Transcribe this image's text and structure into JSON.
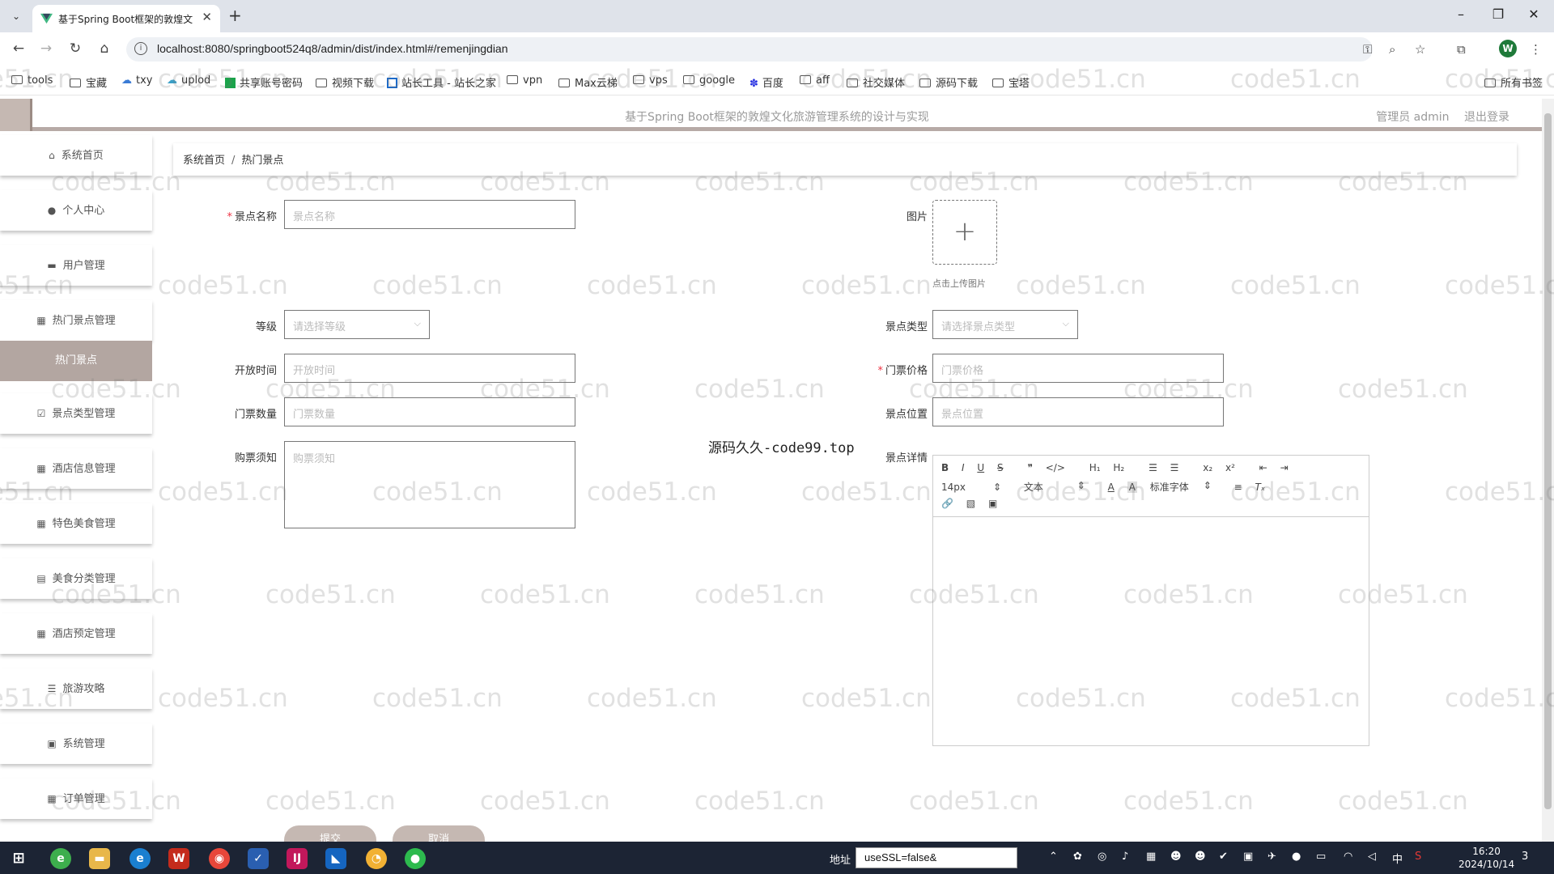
{
  "browser": {
    "tab_title": "基于Spring Boot框架的敦煌文",
    "new_tab_symbol": "+",
    "url": "localhost:8080/springboot524q8/admin/dist/index.html#/remenjingdian",
    "profile_initial": "W",
    "bookmarks": [
      "tools",
      "宝藏",
      "txy",
      "uplod",
      "共享账号密码",
      "视频下载",
      "站长工具 - 站长之家",
      "vpn",
      "Max云梯",
      "vps",
      "google",
      "百度",
      "aff",
      "社交媒体",
      "源码下载",
      "宝塔",
      "所有书签"
    ]
  },
  "header": {
    "title": "基于Spring Boot框架的敦煌文化旅游管理系统的设计与实现",
    "user_label": "管理员 admin",
    "logout": "退出登录"
  },
  "sidebar": {
    "items": [
      {
        "label": "系统首页",
        "icon": "home-icon"
      },
      {
        "label": "个人中心",
        "icon": "user-icon"
      },
      {
        "label": "用户管理",
        "icon": "users-icon"
      },
      {
        "label": "热门景点管理",
        "icon": "grid-icon"
      },
      {
        "label": "热门景点",
        "icon": ""
      },
      {
        "label": "景点类型管理",
        "icon": "check-square-icon"
      },
      {
        "label": "酒店信息管理",
        "icon": "grid-icon"
      },
      {
        "label": "特色美食管理",
        "icon": "grid-icon"
      },
      {
        "label": "美食分类管理",
        "icon": "clipboard-icon"
      },
      {
        "label": "酒店预定管理",
        "icon": "grid-icon"
      },
      {
        "label": "旅游攻略",
        "icon": "list-icon"
      },
      {
        "label": "系统管理",
        "icon": "clipboard-check-icon"
      },
      {
        "label": "订单管理",
        "icon": "grid-icon"
      }
    ],
    "active_color": "#b3a6a1"
  },
  "breadcrumb": {
    "home": "系统首页",
    "separator": "/",
    "current": "热门景点"
  },
  "form": {
    "name_label": "景点名称",
    "name_placeholder": "景点名称",
    "image_label": "图片",
    "upload_tip": "点击上传图片",
    "level_label": "等级",
    "level_placeholder": "请选择等级",
    "type_label": "景点类型",
    "type_placeholder": "请选择景点类型",
    "open_label": "开放时间",
    "open_placeholder": "开放时间",
    "price_label": "门票价格",
    "price_placeholder": "门票价格",
    "count_label": "门票数量",
    "count_placeholder": "门票数量",
    "location_label": "景点位置",
    "location_placeholder": "景点位置",
    "notice_label": "购票须知",
    "notice_placeholder": "购票须知",
    "detail_label": "景点详情",
    "editor_font_size": "14px",
    "editor_format": "文本",
    "editor_font": "标准字体",
    "submit": "提交",
    "cancel": "取消"
  },
  "overlay_text": "源码久久-code99.top",
  "watermark_text": "code51.cn",
  "taskbar": {
    "addr_label": "地址",
    "addr_value": "useSSL=false&",
    "ime": "中",
    "time": "16:20",
    "date": "2024/10/14",
    "notification_count": "3"
  }
}
